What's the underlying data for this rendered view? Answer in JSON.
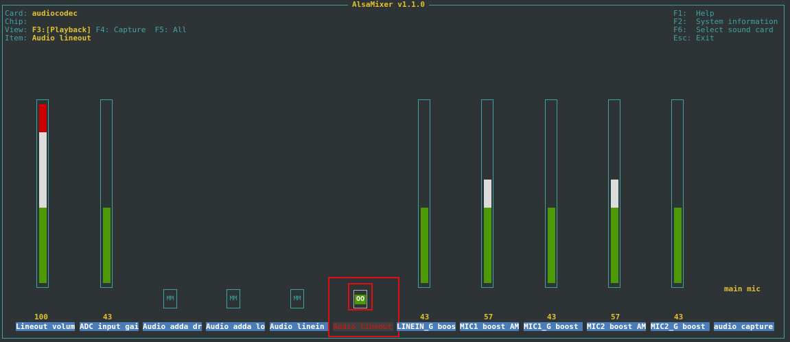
{
  "window": {
    "title": "AlsaMixer v1.1.0"
  },
  "info": {
    "card_label": "Card:",
    "card_value": "audiocodec",
    "chip_label": "Chip:",
    "view_label": "View:",
    "view_playback": "F3:[Playback]",
    "view_capture": "F4: Capture",
    "view_all": "F5: All",
    "item_label": "Item:",
    "item_value": "Audio lineout"
  },
  "help": [
    "F1:  Help",
    "F2:  System information",
    "F6:  Select sound card",
    "Esc: Exit"
  ],
  "channels": [
    {
      "label": "Lineout volum",
      "level": "100",
      "type": "slider",
      "fill_pct": 100
    },
    {
      "label": "ADC input gai",
      "level": "43",
      "type": "slider",
      "fill_pct": 43
    },
    {
      "label": "Audio adda dr",
      "level": "",
      "type": "switch",
      "switch_text": "MM"
    },
    {
      "label": "Audio adda lo",
      "level": "",
      "type": "switch",
      "switch_text": "MM"
    },
    {
      "label": "Audio linein",
      "level": "",
      "type": "switch",
      "switch_text": "MM"
    },
    {
      "label": "Audio lineout",
      "level": "",
      "type": "switch",
      "switch_text": "OO",
      "selected": true
    },
    {
      "label": "LINEIN_G boos",
      "level": "43",
      "type": "slider",
      "fill_pct": 43
    },
    {
      "label": "MIC1 boost AM",
      "level": "57",
      "type": "slider",
      "fill_pct": 57
    },
    {
      "label": "MIC1_G boost",
      "level": "43",
      "type": "slider",
      "fill_pct": 43
    },
    {
      "label": "MIC2 boost AM",
      "level": "57",
      "type": "slider",
      "fill_pct": 57
    },
    {
      "label": "MIC2_G boost",
      "level": "43",
      "type": "slider",
      "fill_pct": 43
    },
    {
      "label": "audio capture",
      "level": "",
      "type": "enum"
    }
  ],
  "capture_enum_value": "main mic",
  "colors": {
    "background": "#2e3436",
    "frame": "#3fa3a3",
    "accent": "#e0c030",
    "label_bg": "#4a7cb8",
    "level_green": "#4e9a06",
    "level_white": "#dcdcdc",
    "level_red": "#cc0000",
    "highlight": "#e01010"
  }
}
